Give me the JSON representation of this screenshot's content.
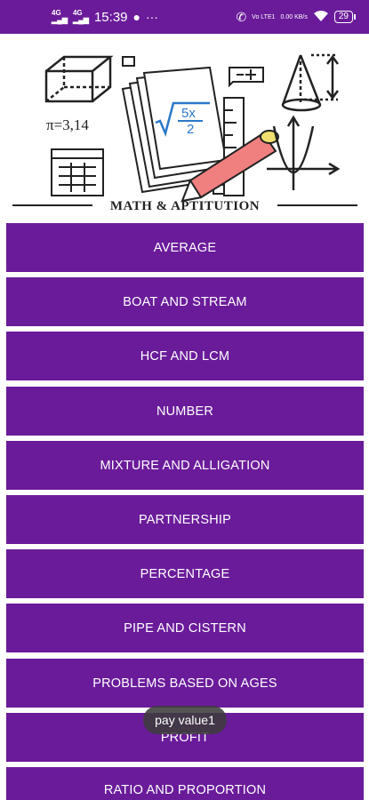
{
  "status_bar": {
    "net1": "4G",
    "net2": "4G",
    "time": "15:39",
    "volte": "Vo LTE1",
    "speed": "0.00 KB/s",
    "battery": "29"
  },
  "header": {
    "title": "MATH & APTITUTION",
    "pi_text": "π=3,14",
    "fraction_num": "5x",
    "fraction_den": "2"
  },
  "menu": {
    "items": [
      {
        "label": "AVERAGE"
      },
      {
        "label": "BOAT AND STREAM"
      },
      {
        "label": "HCF AND LCM"
      },
      {
        "label": "NUMBER"
      },
      {
        "label": "MIXTURE AND ALLIGATION"
      },
      {
        "label": "PARTNERSHIP"
      },
      {
        "label": "PERCENTAGE"
      },
      {
        "label": "PIPE AND CISTERN"
      },
      {
        "label": "PROBLEMS BASED ON AGES"
      },
      {
        "label": "PROFIT"
      },
      {
        "label": "RATIO AND PROPORTION"
      }
    ]
  },
  "toast": {
    "text": "pay value1"
  },
  "colors": {
    "primary": "#6a1b9a",
    "on_primary": "#ffffff"
  }
}
